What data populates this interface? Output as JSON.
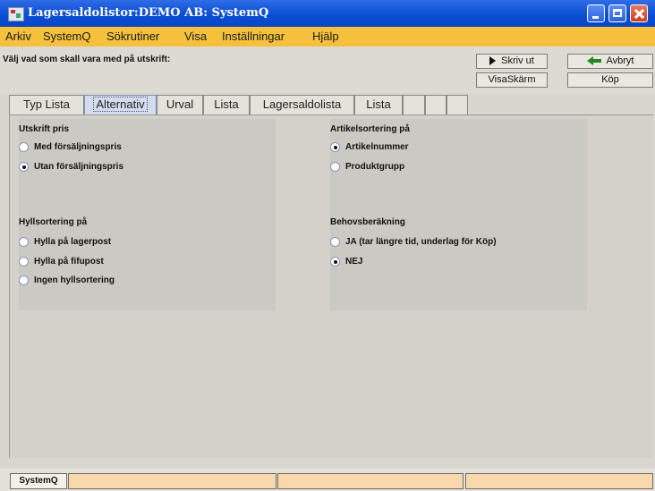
{
  "window": {
    "title": "Lagersaldolistor:DEMO AB: SystemQ"
  },
  "menu": [
    "Arkiv",
    "SystemQ",
    "Sökrutiner",
    "Visa",
    "Inställningar",
    "Hjälp"
  ],
  "toolbar": {
    "prompt": "Välj vad som skall vara med på utskrift:",
    "print_label": "Skriv ut",
    "cancel_label": "Avbryt",
    "screen_label": "VisaSkärm",
    "buy_label": "Köp"
  },
  "tabs": [
    "Typ Lista",
    "Alternativ",
    "Urval",
    "Lista",
    "Lagersaldolista",
    "Lista",
    "",
    "",
    ""
  ],
  "active_tab": "Alternativ",
  "groups": {
    "utskrift_pris": {
      "label": "Utskrift pris",
      "options": [
        "Med försäljningspris",
        "Utan försäljningspris"
      ],
      "selected": "Utan försäljningspris"
    },
    "artikelsortering": {
      "label": "Artikelsortering på",
      "options": [
        "Artikelnummer",
        "Produktgrupp"
      ],
      "selected": "Artikelnummer"
    },
    "hyllsortering": {
      "label": "Hyllsortering på",
      "options": [
        "Hylla på lagerpost",
        "Hylla på fifupost",
        "Ingen hyllsortering"
      ],
      "selected": ""
    },
    "behovsberakning": {
      "label": "Behovsberäkning",
      "options": [
        "JA (tar längre tid, underlag för Köp)",
        "NEJ"
      ],
      "selected": "NEJ"
    }
  },
  "status": {
    "app": "SystemQ"
  },
  "colors": {
    "titlebar": "#0a4ed3",
    "menubar": "#f5c13d",
    "status_segment": "#fad8ae"
  }
}
